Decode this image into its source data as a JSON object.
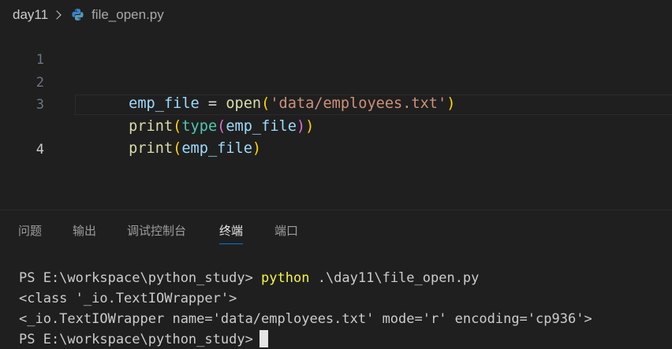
{
  "breadcrumb": {
    "folder": "day11",
    "file": "file_open.py",
    "file_icon": "python-icon"
  },
  "editor": {
    "lines": [
      {
        "number": "1",
        "tokens": [
          {
            "text": "emp_file",
            "kind": "var"
          },
          {
            "text": " = ",
            "kind": "op"
          },
          {
            "text": "open",
            "kind": "fn"
          },
          {
            "text": "(",
            "kind": "p1"
          },
          {
            "text": "'data/employees.txt'",
            "kind": "str"
          },
          {
            "text": ")",
            "kind": "p1"
          }
        ]
      },
      {
        "number": "2",
        "tokens": [
          {
            "text": "print",
            "kind": "fn"
          },
          {
            "text": "(",
            "kind": "p1"
          },
          {
            "text": "type",
            "kind": "cls"
          },
          {
            "text": "(",
            "kind": "p2"
          },
          {
            "text": "emp_file",
            "kind": "var"
          },
          {
            "text": ")",
            "kind": "p2"
          },
          {
            "text": ")",
            "kind": "p1"
          }
        ]
      },
      {
        "number": "3",
        "tokens": [
          {
            "text": "print",
            "kind": "fn"
          },
          {
            "text": "(",
            "kind": "p1"
          },
          {
            "text": "emp_file",
            "kind": "var"
          },
          {
            "text": ")",
            "kind": "p1"
          }
        ]
      },
      {
        "number": "4",
        "tokens": []
      }
    ],
    "active_line": "4"
  },
  "panel": {
    "tabs": [
      {
        "label": "问题",
        "name": "tab-problems",
        "active": false
      },
      {
        "label": "输出",
        "name": "tab-output",
        "active": false
      },
      {
        "label": "调试控制台",
        "name": "tab-debug-console",
        "active": false
      },
      {
        "label": "终端",
        "name": "tab-terminal",
        "active": true
      },
      {
        "label": "端口",
        "name": "tab-ports",
        "active": false
      }
    ]
  },
  "terminal": {
    "prompt": "PS E:\\workspace\\python_study> ",
    "command": "python",
    "command_args": " .\\day11\\file_open.py",
    "output_1": "<class '_io.TextIOWrapper'>",
    "output_2": "<_io.TextIOWrapper name='data/employees.txt' mode='r' encoding='cp936'>",
    "prompt_2": "PS E:\\workspace\\python_study>"
  },
  "colors": {
    "background": "#1f1f1f",
    "variable": "#9cdcfe",
    "function": "#dcdcaa",
    "class": "#4ec9b0",
    "string": "#ce9178",
    "bracket_1": "#ffd700",
    "bracket_2": "#da70d6",
    "command": "#f5f543",
    "tab_underline": "#0078d4"
  }
}
